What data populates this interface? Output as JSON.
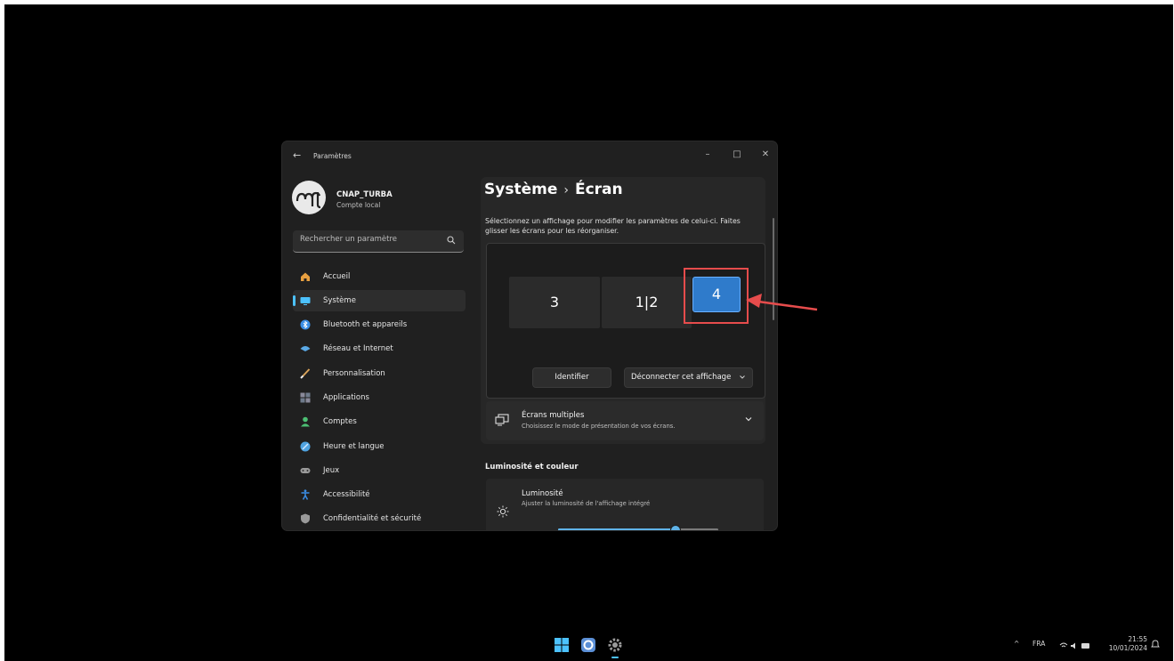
{
  "window": {
    "title": "Paramètres",
    "back": "←",
    "min": "–",
    "max": "□",
    "close": "✕"
  },
  "profile": {
    "name": "CNAP_TURBA",
    "account_type": "Compte local"
  },
  "search": {
    "placeholder": "Rechercher un paramètre"
  },
  "sidebar": {
    "items": [
      {
        "label": "Accueil",
        "icon": "home-icon",
        "color": "#e8a040"
      },
      {
        "label": "Système",
        "icon": "system-icon",
        "color": "#4cc2ff",
        "active": true
      },
      {
        "label": "Bluetooth et appareils",
        "icon": "bluetooth-icon",
        "color": "#3a8ee6"
      },
      {
        "label": "Réseau et Internet",
        "icon": "network-icon",
        "color": "#5aa9e6"
      },
      {
        "label": "Personnalisation",
        "icon": "brush-icon",
        "color": "#d9a35a"
      },
      {
        "label": "Applications",
        "icon": "apps-icon",
        "color": "#8a8a9a"
      },
      {
        "label": "Comptes",
        "icon": "accounts-icon",
        "color": "#4cbf73"
      },
      {
        "label": "Heure et langue",
        "icon": "time-language-icon",
        "color": "#4fa3e0"
      },
      {
        "label": "Jeux",
        "icon": "gaming-icon",
        "color": "#9a9a9a"
      },
      {
        "label": "Accessibilité",
        "icon": "accessibility-icon",
        "color": "#3a8ee6"
      },
      {
        "label": "Confidentialité et sécurité",
        "icon": "shield-icon",
        "color": "#9a9a9a"
      }
    ]
  },
  "breadcrumb": {
    "parent": "Système",
    "separator": "›",
    "current": "Écran"
  },
  "display": {
    "description": "Sélectionnez un affichage pour modifier les paramètres de celui-ci. Faites glisser les écrans pour les réorganiser.",
    "monitors": [
      {
        "label": "3"
      },
      {
        "label": "1|2"
      },
      {
        "label": "4",
        "selected": true
      }
    ],
    "identify_label": "Identifier",
    "disconnect_label": "Déconnecter cet affichage",
    "multi": {
      "title": "Écrans multiples",
      "subtitle": "Choisissez le mode de présentation de vos écrans."
    }
  },
  "brightness_section": {
    "heading": "Luminosité et couleur",
    "title": "Luminosité",
    "subtitle": "Ajuster la luminosité de l'affichage intégré",
    "level": 0.73
  },
  "taskbar": {
    "tray_lang": "FRA",
    "time": "21:55",
    "date": "10/01/2024"
  },
  "colors": {
    "accent": "#4cc2ff",
    "annotation": "#e64c4c"
  }
}
